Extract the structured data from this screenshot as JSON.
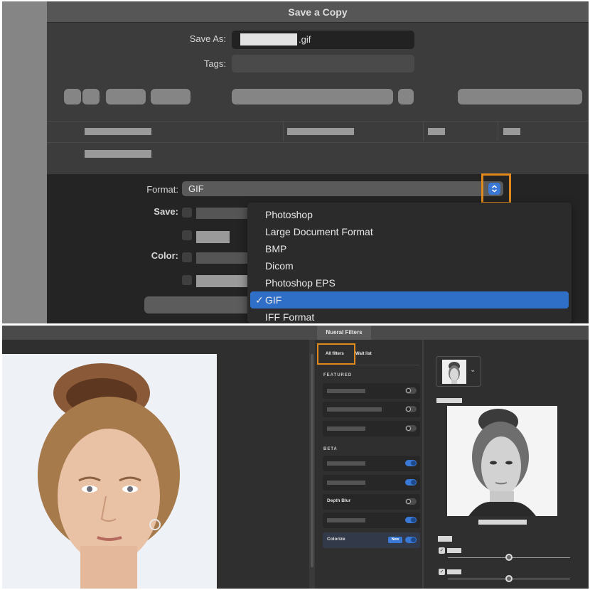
{
  "save_dialog": {
    "title": "Save a Copy",
    "save_as_label": "Save As:",
    "save_as_extension": ".gif",
    "tags_label": "Tags:",
    "format_label": "Format:",
    "format_value": "GIF",
    "save_label": "Save:",
    "color_label": "Color:",
    "format_menu": {
      "items": [
        {
          "label": "Photoshop",
          "selected": false
        },
        {
          "label": "Large Document Format",
          "selected": false
        },
        {
          "label": "BMP",
          "selected": false
        },
        {
          "label": "Dicom",
          "selected": false
        },
        {
          "label": "Photoshop EPS",
          "selected": false
        },
        {
          "label": "GIF",
          "selected": true
        },
        {
          "label": "IFF Format",
          "selected": false
        }
      ],
      "check_glyph": "✓"
    },
    "stepper_icon": "chevron-up-down-icon",
    "highlight_color": "#e08a1e",
    "accent_color": "#2f6fc8"
  },
  "neural_filters": {
    "tab_label": "Nueral Filters",
    "tabs": [
      {
        "label": "All filters",
        "active": true
      },
      {
        "label": "Wait list",
        "active": false
      }
    ],
    "featured_heading": "FEATURED",
    "beta_heading": "BETA",
    "featured": [
      {
        "label": "",
        "enabled": false
      },
      {
        "label": "",
        "enabled": false
      },
      {
        "label": "",
        "enabled": false
      }
    ],
    "beta": [
      {
        "label": "",
        "enabled": true
      },
      {
        "label": "",
        "enabled": true
      },
      {
        "label": "Depth Blur",
        "enabled": false
      },
      {
        "label": "",
        "enabled": true
      },
      {
        "label": "Colorize",
        "enabled": true,
        "badge": "New"
      }
    ],
    "sliders": [
      {
        "checked": true,
        "value": 0.5
      },
      {
        "checked": true,
        "value": 0.5
      }
    ],
    "dropdown_icon": "chevron-down-icon"
  }
}
